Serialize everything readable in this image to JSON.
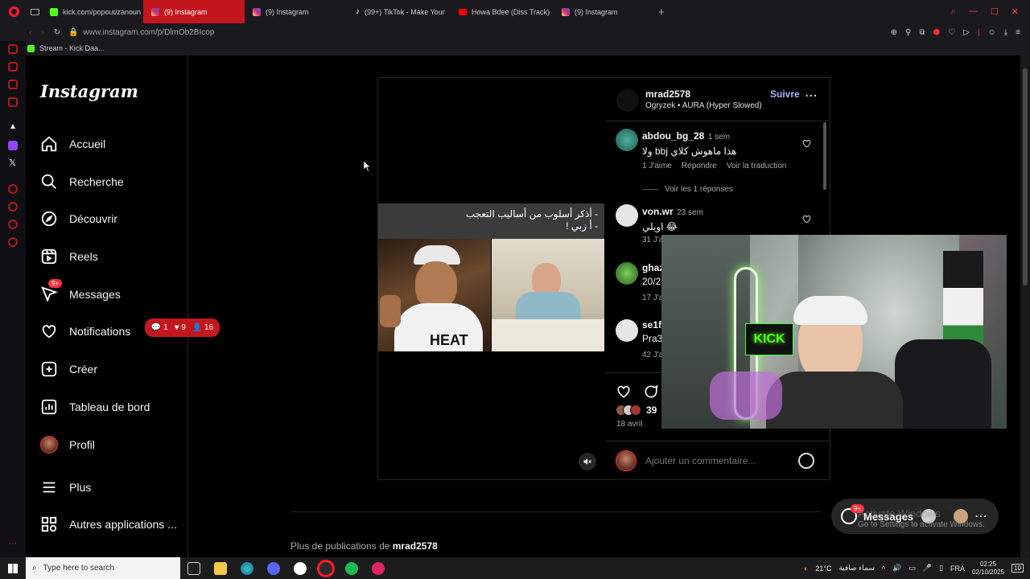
{
  "browser": {
    "tabs": [
      {
        "label": "kick.com/popout/zanoun",
        "icon": "kick-icon",
        "color": "#53fc18"
      },
      {
        "label": "(9) Instagram",
        "icon": "instagram-icon",
        "color": "#e1306c",
        "active": true
      },
      {
        "label": "(9) Instagram",
        "icon": "instagram-icon",
        "color": "#e1306c"
      },
      {
        "label": "(99+) TikTok - Make Your",
        "icon": "tiktok-icon",
        "color": "#ffffff"
      },
      {
        "label": "Howa Bdee (Diss Track)",
        "icon": "youtube-icon",
        "color": "#ff0000"
      },
      {
        "label": "(9) Instagram",
        "icon": "instagram-icon",
        "color": "#e1306c"
      }
    ],
    "url": "www.instagram.com/p/DlmOb2BIcop",
    "bookmark": "Stream - Kick Daa..."
  },
  "sidebar": {
    "logo": "Instagram",
    "items": [
      {
        "label": "Accueil",
        "icon": "home-icon"
      },
      {
        "label": "Recherche",
        "icon": "search-icon"
      },
      {
        "label": "Découvrir",
        "icon": "compass-icon"
      },
      {
        "label": "Reels",
        "icon": "reels-icon"
      },
      {
        "label": "Messages",
        "icon": "messages-icon",
        "badge": "9+"
      },
      {
        "label": "Notifications",
        "icon": "heart-icon"
      },
      {
        "label": "Créer",
        "icon": "plus-square-icon"
      },
      {
        "label": "Tableau de bord",
        "icon": "dashboard-icon"
      },
      {
        "label": "Profil",
        "icon": "avatar"
      },
      {
        "label": "Plus",
        "icon": "menu-icon"
      },
      {
        "label": "Autres applications ...",
        "icon": "apps-icon"
      }
    ],
    "notif_pill": {
      "comments": "1",
      "likes": "9",
      "follows": "16"
    }
  },
  "post": {
    "caption_line1": "- أذكر أسلوب من أساليب التعجب",
    "caption_line2": "- أ زبي !",
    "image_left_text": "HEAT",
    "author": "mrad2578",
    "follow_label": "Suivre",
    "audio": "Ogryzek • AURA (Hyper Slowed)",
    "comments": [
      {
        "user": "abdou_bg_28",
        "time": "1 sem",
        "text": "هذا ماهوش كلاي bbj ولا",
        "likes": "1 J'aime",
        "reply": "Répondre",
        "translate": "Voir la traduction",
        "replies": "Voir les 1 réponses"
      },
      {
        "user": "von.wr",
        "time": "23 sem",
        "text": "😂 اويلي",
        "meta": "31 J'a"
      },
      {
        "user": "ghaz",
        "text": "20/2",
        "meta": "17 J'a"
      },
      {
        "user": "se1f_",
        "text": "Pra3",
        "meta": "42 J'a"
      }
    ],
    "likes_count": "39",
    "date": "18 avril",
    "comment_placeholder": "Ajouter un commentaire..."
  },
  "webcam": {
    "sign": "KICK"
  },
  "more_label": "Plus de publications de",
  "more_user": "mrad2578",
  "messages_pill": {
    "label": "Messages",
    "badge": "9+"
  },
  "watermark": {
    "line1": "Activate Windows",
    "line2": "Go to Settings to activate Windows."
  },
  "taskbar": {
    "search_placeholder": "Type here to search",
    "weather": "21°C",
    "weather_text": "سماء صافية",
    "lang": "FRA",
    "time": "02:25",
    "date": "02/10/2025",
    "notif": "10"
  }
}
